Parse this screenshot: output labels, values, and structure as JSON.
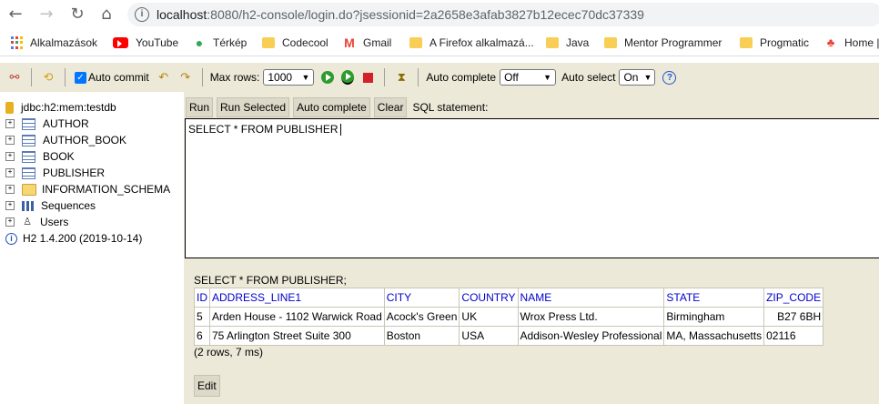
{
  "browser": {
    "url_host": "localhost",
    "url_rest": ":8080/h2-console/login.do?jsessionid=2a2658e3afab3827b12ecec70dc37339",
    "bookmarks": [
      {
        "label": "Alkalmazások",
        "icon": "apps-grid-icon"
      },
      {
        "label": "YouTube",
        "icon": "youtube-icon"
      },
      {
        "label": "Térkép",
        "icon": "maps-pin-icon"
      },
      {
        "label": "Codecool",
        "icon": "folder-icon"
      },
      {
        "label": "Gmail",
        "icon": "gmail-icon"
      },
      {
        "label": "A Firefox alkalmazá...",
        "icon": "folder-icon"
      },
      {
        "label": "Java",
        "icon": "folder-icon"
      },
      {
        "label": "Mentor Programmer",
        "icon": "folder-icon"
      },
      {
        "label": "Progmatic",
        "icon": "folder-icon"
      },
      {
        "label": "Home |",
        "icon": "home-site-icon"
      }
    ]
  },
  "toolbar": {
    "auto_commit_label": "Auto commit",
    "max_rows_label": "Max rows:",
    "max_rows_value": "1000",
    "auto_complete_label": "Auto complete",
    "auto_complete_value": "Off",
    "auto_select_label": "Auto select",
    "auto_select_value": "On",
    "help_glyph": "?"
  },
  "tree": {
    "connection": "jdbc:h2:mem:testdb",
    "items": [
      {
        "label": "AUTHOR",
        "type": "table"
      },
      {
        "label": "AUTHOR_BOOK",
        "type": "table"
      },
      {
        "label": "BOOK",
        "type": "table"
      },
      {
        "label": "PUBLISHER",
        "type": "table"
      },
      {
        "label": "INFORMATION_SCHEMA",
        "type": "folder"
      },
      {
        "label": "Sequences",
        "type": "sequences"
      },
      {
        "label": "Users",
        "type": "users"
      }
    ],
    "version": "H2 1.4.200 (2019-10-14)"
  },
  "sql_panel": {
    "run_label": "Run",
    "run_selected_label": "Run Selected",
    "auto_complete_label": "Auto complete",
    "clear_label": "Clear",
    "statement_label": "SQL statement:",
    "query": "SELECT * FROM PUBLISHER"
  },
  "result": {
    "query": "SELECT * FROM PUBLISHER;",
    "columns": [
      "ID",
      "ADDRESS_LINE1",
      "CITY",
      "COUNTRY",
      "NAME",
      "STATE",
      "ZIP_CODE"
    ],
    "rows": [
      [
        "5",
        "Arden House - 1102 Warwick Road",
        "Acock's Green",
        "UK",
        "Wrox Press Ltd.",
        "Birmingham",
        "B27 6BH"
      ],
      [
        "6",
        "75 Arlington Street Suite 300",
        "Boston",
        "USA",
        "Addison-Wesley Professional",
        "MA, Massachusetts",
        "02116"
      ]
    ],
    "summary": "(2 rows, 7 ms)",
    "edit_label": "Edit"
  }
}
